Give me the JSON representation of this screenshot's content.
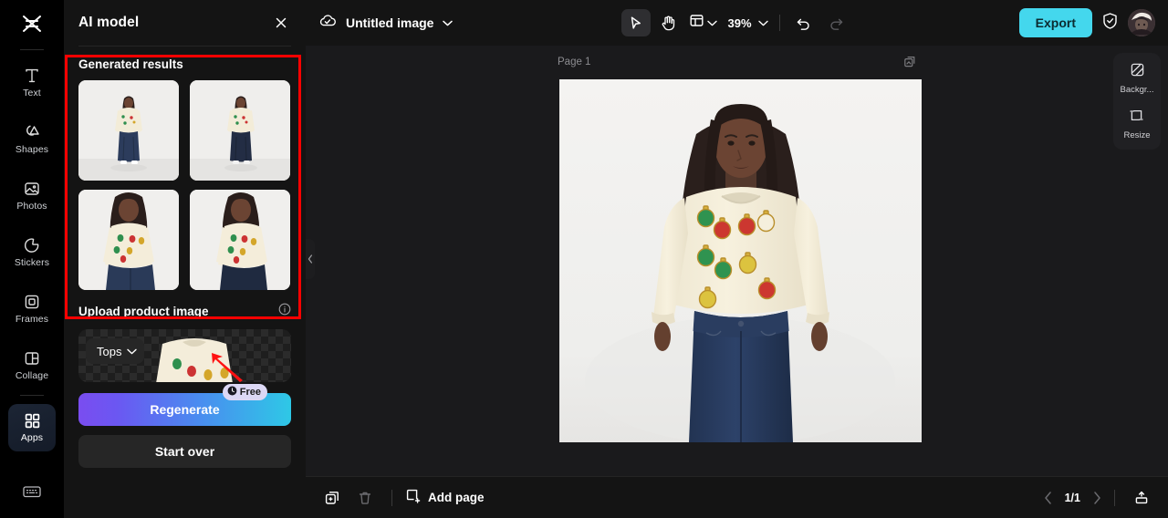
{
  "app": {
    "brand_icon": "capcut-logo-icon",
    "accent_export": "#44d7ed",
    "annotation_color": "#ff0000"
  },
  "sidebar": {
    "items": [
      {
        "label": "Text",
        "icon": "text-icon",
        "active": false
      },
      {
        "label": "Shapes",
        "icon": "shapes-icon",
        "active": false
      },
      {
        "label": "Photos",
        "icon": "photos-icon",
        "active": false
      },
      {
        "label": "Stickers",
        "icon": "stickers-icon",
        "active": false
      },
      {
        "label": "Frames",
        "icon": "frames-icon",
        "active": false
      },
      {
        "label": "Collage",
        "icon": "collage-icon",
        "active": false
      },
      {
        "label": "Apps",
        "icon": "apps-icon",
        "active": true
      }
    ],
    "bottom_icon": "keyboard-icon"
  },
  "panel": {
    "title": "AI model",
    "close_icon": "close-icon",
    "results": {
      "title": "Generated results",
      "thumbnails": [
        {
          "alt": "model-full-body-front"
        },
        {
          "alt": "model-full-body-side"
        },
        {
          "alt": "model-waist-up-front"
        },
        {
          "alt": "model-waist-up-turned"
        }
      ]
    },
    "upload": {
      "label": "Upload product image",
      "info_icon": "info-icon",
      "category_value": "Tops",
      "category_chevron": "chevron-down-icon"
    },
    "regenerate": {
      "label": "Regenerate",
      "badge_label": "Free",
      "badge_icon": "clock-icon"
    },
    "start_over": {
      "label": "Start over"
    },
    "collapse_icon": "chevron-left-icon"
  },
  "topbar": {
    "cloud_icon": "cloud-saved-icon",
    "doc_title": "Untitled image",
    "doc_chevron": "chevron-down-icon",
    "tools": [
      {
        "name": "cursor-tool",
        "icon": "cursor-icon",
        "active": true
      },
      {
        "name": "hand-tool",
        "icon": "hand-icon",
        "active": false
      }
    ],
    "layout_icon": "layout-icon",
    "layout_chevron": "chevron-down-icon",
    "zoom_level": "39%",
    "zoom_chevron": "chevron-down-icon",
    "undo_icon": "undo-icon",
    "redo_icon": "redo-icon",
    "export_label": "Export",
    "shield_icon": "shield-check-icon",
    "avatar": "user-avatar"
  },
  "canvas": {
    "page_label": "Page 1",
    "page_copy_icon": "duplicate-page-icon",
    "artboard_alt": "model-wearing-cream-ornament-sweater"
  },
  "float_tools": [
    {
      "label": "Backgr...",
      "icon": "background-icon"
    },
    {
      "label": "Resize",
      "icon": "resize-icon"
    }
  ],
  "bottombar": {
    "duplicate_icon": "duplicate-icon",
    "delete_icon": "trash-icon",
    "add_page_icon": "add-page-icon",
    "add_page_label": "Add page",
    "prev_icon": "chevron-left-icon",
    "page_indicator": "1/1",
    "next_icon": "chevron-right-icon",
    "panel_toggle_icon": "collapse-panel-icon"
  }
}
